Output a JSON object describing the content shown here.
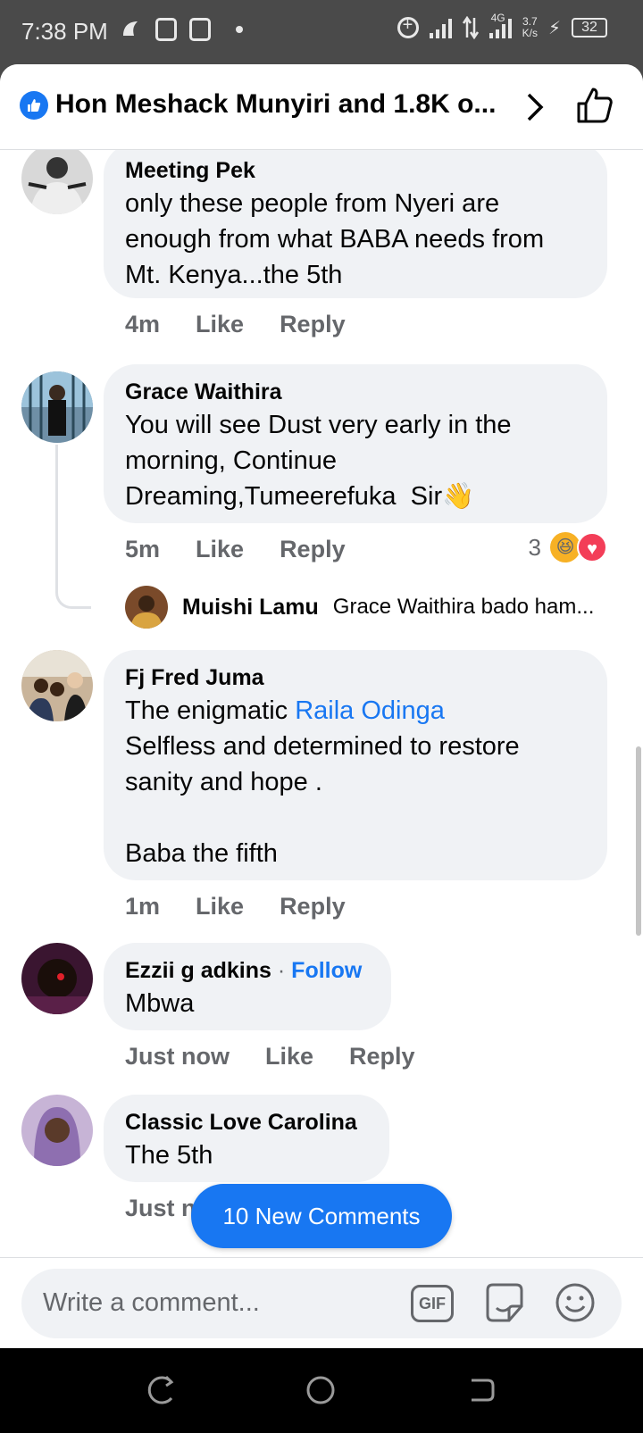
{
  "status_bar": {
    "time": "7:38 PM",
    "network": "4G",
    "speed_value": "3.7",
    "speed_unit": "K/s",
    "battery": "32"
  },
  "header": {
    "title": "Hon Meshack Munyiri and 1.8K o..."
  },
  "comments": [
    {
      "author": "Meeting Pek",
      "text": "only these people from Nyeri are enough from what BABA needs from Mt. Kenya...the 5th",
      "time": "4m",
      "like": "Like",
      "reply": "Reply"
    },
    {
      "author": "Grace Waithira",
      "text": "You will see Dust very early in the morning, Continue Dreaming,Tumeerefuka  Sir👋",
      "time": "5m",
      "like": "Like",
      "reply": "Reply",
      "reaction_count": "3",
      "reply_preview": {
        "author": "Muishi Lamu",
        "text": "Grace Waithira bado ham..."
      }
    },
    {
      "author": "Fj Fred Juma",
      "text_prefix": "The enigmatic ",
      "mention": "Raila Odinga",
      "text_rest": "Selfless and determined to restore sanity and hope .\n\nBaba the fifth",
      "time": "1m",
      "like": "Like",
      "reply": "Reply"
    },
    {
      "author": "Ezzii g adkins",
      "separator": "·",
      "follow": "Follow",
      "text": "Mbwa",
      "time": "Just now",
      "like": "Like",
      "reply": "Reply"
    },
    {
      "author": "Classic Love Carolina",
      "text": "The 5th",
      "time": "Just no"
    }
  ],
  "new_comments_button": "10 New Comments",
  "composer": {
    "placeholder": "Write a comment...",
    "gif_label": "GIF"
  },
  "icons": {
    "like_badge": "thumbs-up-icon",
    "chevron": "chevron-right-icon",
    "like_page": "thumbs-up-outline-icon",
    "sticker": "sticker-icon",
    "emoji": "emoji-icon",
    "nav_recents": "recents-icon",
    "nav_home": "home-icon",
    "nav_back": "back-icon"
  },
  "colors": {
    "accent": "#1877f2",
    "bubble": "#f0f2f5",
    "secondary_text": "#65676b"
  }
}
